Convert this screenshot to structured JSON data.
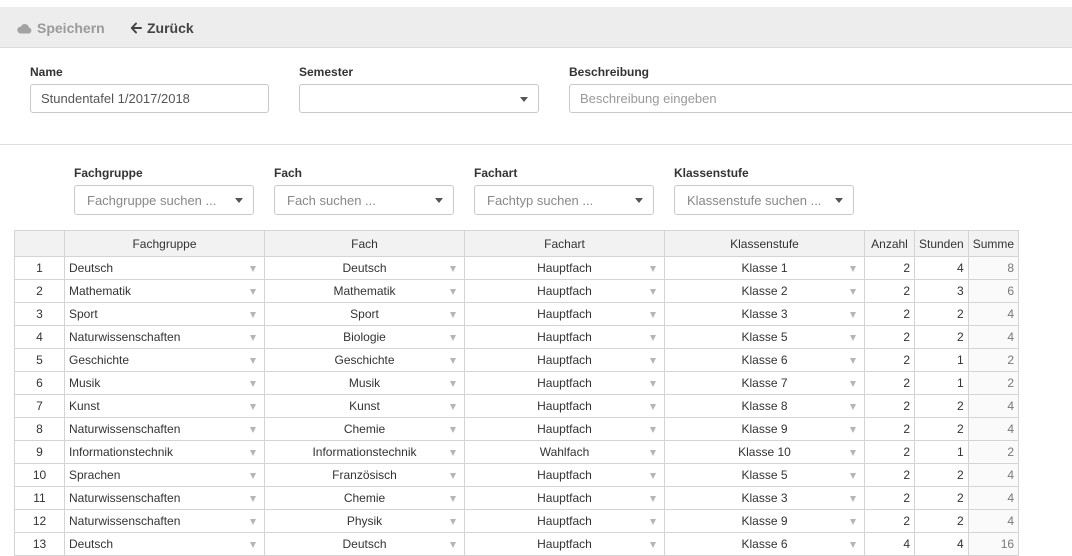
{
  "toolbar": {
    "save_label": "Speichern",
    "back_label": "Zurück"
  },
  "form": {
    "name_label": "Name",
    "name_value": "Stundentafel 1/2017/2018",
    "semester_label": "Semester",
    "semester_value": "",
    "description_label": "Beschreibung",
    "description_placeholder": "Beschreibung eingeben"
  },
  "filters": [
    {
      "label": "Fachgruppe",
      "placeholder": "Fachgruppe suchen ..."
    },
    {
      "label": "Fach",
      "placeholder": "Fach suchen ..."
    },
    {
      "label": "Fachart",
      "placeholder": "Fachtyp suchen ..."
    },
    {
      "label": "Klassenstufe",
      "placeholder": "Klassenstufe suchen ..."
    }
  ],
  "table": {
    "headers": [
      "",
      "Fachgruppe",
      "Fach",
      "Fachart",
      "Klassenstufe",
      "Anzahl",
      "Stunden",
      "Summe"
    ],
    "rows": [
      [
        "1",
        "Deutsch",
        "Deutsch",
        "Hauptfach",
        "Klasse 1",
        "2",
        "4",
        "8"
      ],
      [
        "2",
        "Mathematik",
        "Mathematik",
        "Hauptfach",
        "Klasse 2",
        "2",
        "3",
        "6"
      ],
      [
        "3",
        "Sport",
        "Sport",
        "Hauptfach",
        "Klasse 3",
        "2",
        "2",
        "4"
      ],
      [
        "4",
        "Naturwissenschaften",
        "Biologie",
        "Hauptfach",
        "Klasse 5",
        "2",
        "2",
        "4"
      ],
      [
        "5",
        "Geschichte",
        "Geschichte",
        "Hauptfach",
        "Klasse 6",
        "2",
        "1",
        "2"
      ],
      [
        "6",
        "Musik",
        "Musik",
        "Hauptfach",
        "Klasse 7",
        "2",
        "1",
        "2"
      ],
      [
        "7",
        "Kunst",
        "Kunst",
        "Hauptfach",
        "Klasse 8",
        "2",
        "2",
        "4"
      ],
      [
        "8",
        "Naturwissenschaften",
        "Chemie",
        "Hauptfach",
        "Klasse 9",
        "2",
        "2",
        "4"
      ],
      [
        "9",
        "Informationstechnik",
        "Informationstechnik",
        "Wahlfach",
        "Klasse 10",
        "2",
        "1",
        "2"
      ],
      [
        "10",
        "Sprachen",
        "Französisch",
        "Hauptfach",
        "Klasse 5",
        "2",
        "2",
        "4"
      ],
      [
        "11",
        "Naturwissenschaften",
        "Chemie",
        "Hauptfach",
        "Klasse 3",
        "2",
        "2",
        "4"
      ],
      [
        "12",
        "Naturwissenschaften",
        "Physik",
        "Hauptfach",
        "Klasse 9",
        "2",
        "2",
        "4"
      ],
      [
        "13",
        "Deutsch",
        "Deutsch",
        "Hauptfach",
        "Klasse 6",
        "4",
        "4",
        "16"
      ]
    ]
  }
}
